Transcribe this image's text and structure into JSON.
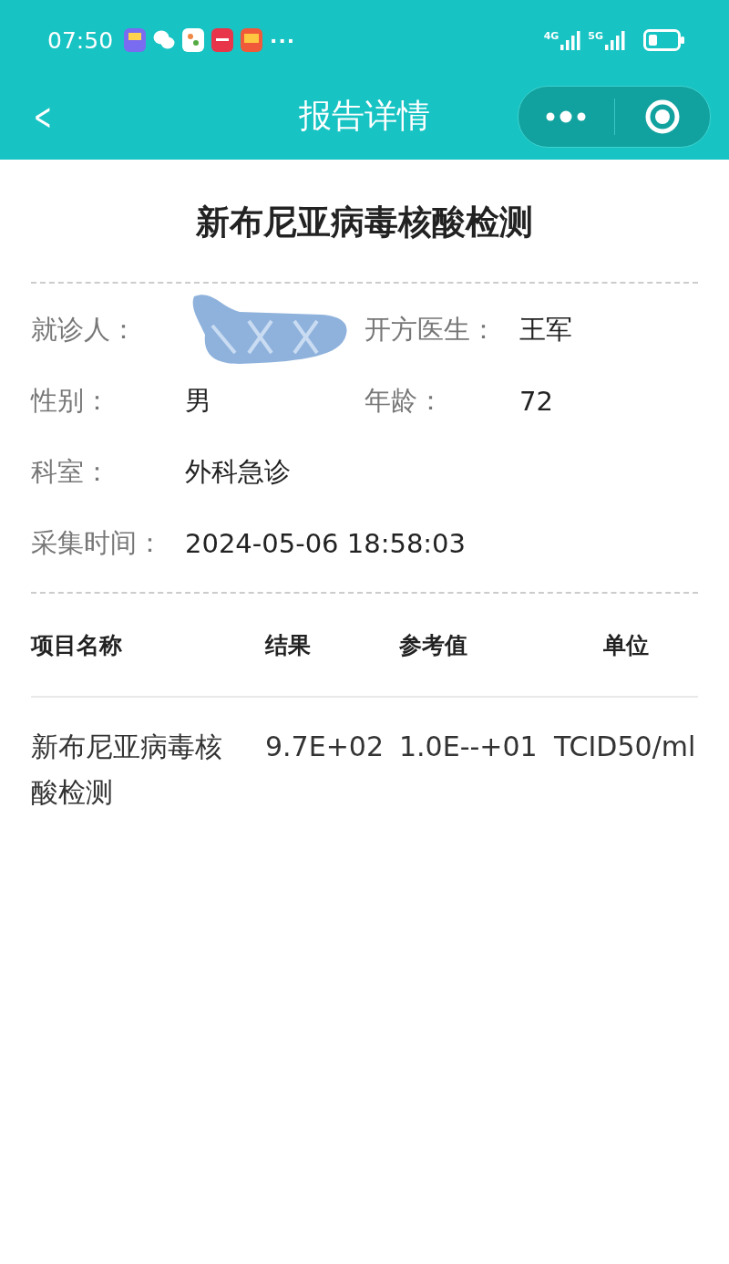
{
  "status_bar": {
    "time": "07:50",
    "more": "···",
    "signals": [
      "4G",
      "5G"
    ]
  },
  "nav": {
    "back": "<",
    "title": "报告详情"
  },
  "report": {
    "title": "新布尼亚病毒核酸检测",
    "fields": [
      {
        "kind": "redacted",
        "label": "就诊人："
      },
      {
        "kind": "text",
        "label": "开方医生：",
        "value": "王军"
      },
      {
        "kind": "text",
        "label": "性别：",
        "value": "男"
      },
      {
        "kind": "text",
        "label": "年龄：",
        "value": "72"
      },
      {
        "kind": "solo",
        "label": "科室：",
        "value": "外科急诊"
      },
      {
        "kind": "wide",
        "label": "采集时间：",
        "value": "2024-05-06 18:58:03"
      }
    ],
    "table": {
      "columns": [
        "项目名称",
        "结果",
        "参考值",
        "单位"
      ],
      "rows": [
        [
          "新布尼亚病毒核酸检测",
          "9.7E+02",
          "1.0E--+01",
          "TCID50/ml"
        ]
      ]
    }
  }
}
